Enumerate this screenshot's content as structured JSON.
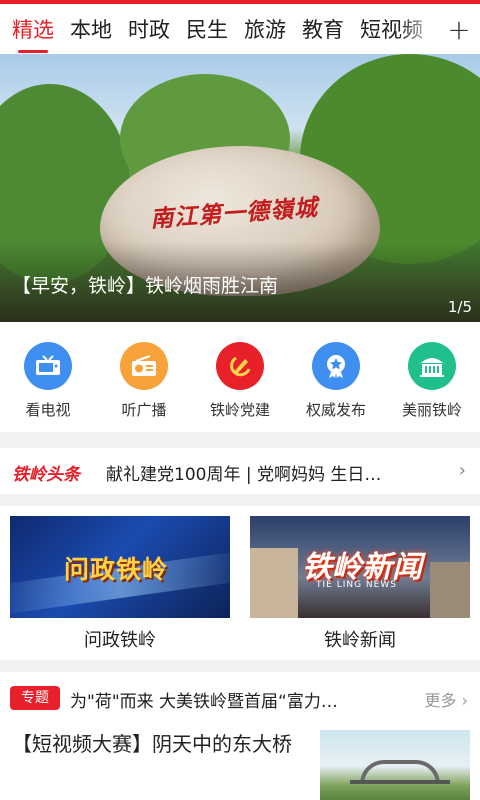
{
  "tabs": {
    "items": [
      "精选",
      "本地",
      "时政",
      "民生",
      "旅游",
      "教育",
      "短视频"
    ],
    "active_index": 0,
    "add_symbol": "+"
  },
  "banner": {
    "rock_inscription": "南江第一德嶺城",
    "caption": "【早安，铁岭】铁岭烟雨胜江南",
    "counter": "1/5"
  },
  "quick_links": [
    {
      "label": "看电视",
      "icon": "tv-icon",
      "color": "#3f8ff0"
    },
    {
      "label": "听广播",
      "icon": "radio-icon",
      "color": "#f7a23b"
    },
    {
      "label": "铁岭党建",
      "icon": "party-emblem-icon",
      "color": "#e8202a"
    },
    {
      "label": "权威发布",
      "icon": "star-badge-icon",
      "color": "#3f8ff0"
    },
    {
      "label": "美丽铁岭",
      "icon": "building-icon",
      "color": "#1fc08d"
    }
  ],
  "headline": {
    "brand": "铁岭头条",
    "text": "献礼建党100周年 | 党啊妈妈 生日…",
    "arrow": "›"
  },
  "cards": [
    {
      "label": "问政铁岭",
      "image_title": "问政铁岭"
    },
    {
      "label": "铁岭新闻",
      "image_title": "铁岭新闻",
      "image_subtitle": "TIE LING NEWS"
    }
  ],
  "special": {
    "badge": "专题",
    "title": "为\"荷\"而来 大美铁岭暨首届“富力…",
    "more": "更多 ›"
  },
  "article": {
    "title": "【短视频大赛】阴天中的东大桥"
  },
  "colors": {
    "accent": "#e8202a"
  }
}
